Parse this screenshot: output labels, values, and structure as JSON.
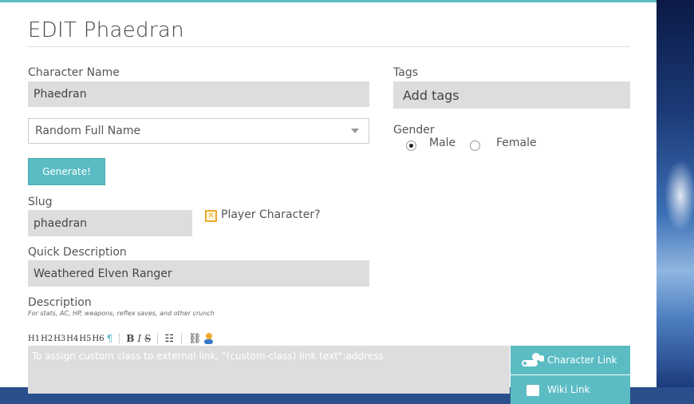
{
  "page": {
    "title": "EDIT Phaedran"
  },
  "form": {
    "character_name_label": "Character Name",
    "character_name_value": "Phaedran",
    "name_generator_selected": "Random Full Name",
    "generate_button": "Generate!",
    "slug_label": "Slug",
    "slug_value": "phaedran",
    "player_character_label": "Player Character?",
    "quick_description_label": "Quick Description",
    "quick_description_value": "Weathered Elven Ranger",
    "description_label": "Description",
    "description_note": "For stats, AC, HP, weapons, reflex saves, and other crunch",
    "description_placeholder": "To assign custom class to external link, \"(custom-class) link text\":address",
    "tags_label": "Tags",
    "tags_placeholder": "Add tags",
    "gender_label": "Gender",
    "gender_options": [
      "Male",
      "Female"
    ],
    "gender_selected": "Male"
  },
  "toolbar": {
    "headings": [
      "H1",
      "H2",
      "H3",
      "H4",
      "H5",
      "H6"
    ],
    "paragraph": "¶",
    "bold": "B",
    "italic": "I",
    "strike": "S",
    "list": "☷",
    "link": "⛓"
  },
  "side_buttons": {
    "character_link": "Character Link",
    "wiki_link": "Wiki Link"
  },
  "colors": {
    "accent": "#5bbcc4",
    "field_bg": "#dddddd",
    "checkbox": "#f0a830"
  }
}
